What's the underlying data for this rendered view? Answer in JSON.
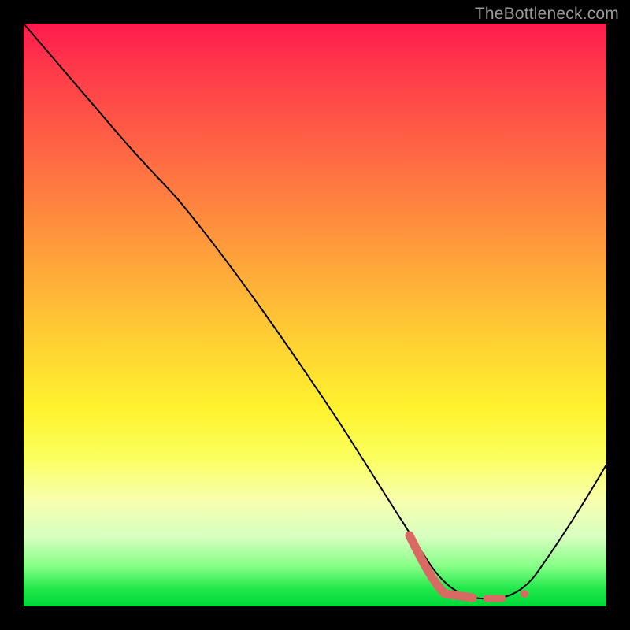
{
  "watermark": "TheBottleneck.com",
  "colors": {
    "gradient_top": "#ff1a4d",
    "gradient_mid": "#fff22e",
    "gradient_bottom": "#00d83a",
    "curve": "#000000",
    "highlight": "#d96a63",
    "frame": "#000000"
  },
  "chart_data": {
    "type": "line",
    "title": "",
    "xlabel": "",
    "ylabel": "",
    "xlim": [
      0,
      100
    ],
    "ylim": [
      0,
      100
    ],
    "grid": false,
    "legend": false,
    "series": [
      {
        "name": "bottleneck-curve",
        "x": [
          0,
          5,
          10,
          15,
          20,
          25,
          30,
          35,
          40,
          45,
          50,
          55,
          60,
          62,
          66,
          70,
          74,
          78,
          82,
          86,
          90,
          95,
          100
        ],
        "y": [
          100,
          93,
          86,
          79,
          72,
          66,
          58,
          50,
          42,
          34,
          26,
          18,
          10,
          6,
          3,
          1.5,
          1,
          1,
          1.2,
          4,
          10,
          18,
          28
        ]
      }
    ],
    "highlight_points": {
      "name": "optimal-range",
      "x": [
        63,
        66,
        69,
        72,
        75,
        78,
        80
      ],
      "y": [
        5.5,
        3,
        2,
        1.4,
        1.1,
        1,
        1.1
      ]
    },
    "note": "y expressed as bottleneck percentage; lower = better (green band near bottom)."
  }
}
